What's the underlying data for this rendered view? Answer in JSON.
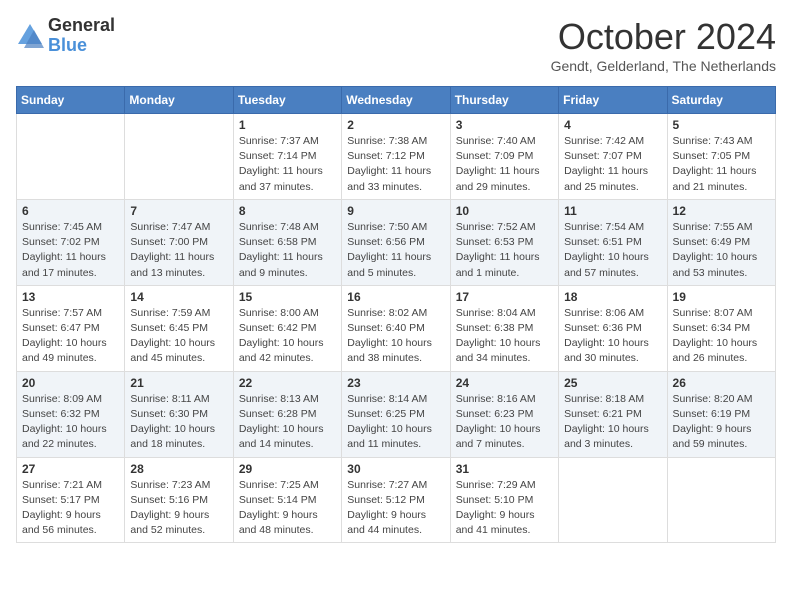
{
  "header": {
    "logo_general": "General",
    "logo_blue": "Blue",
    "month_title": "October 2024",
    "location": "Gendt, Gelderland, The Netherlands"
  },
  "days_of_week": [
    "Sunday",
    "Monday",
    "Tuesday",
    "Wednesday",
    "Thursday",
    "Friday",
    "Saturday"
  ],
  "weeks": [
    [
      {
        "day": "",
        "info": ""
      },
      {
        "day": "",
        "info": ""
      },
      {
        "day": "1",
        "info": "Sunrise: 7:37 AM\nSunset: 7:14 PM\nDaylight: 11 hours and 37 minutes."
      },
      {
        "day": "2",
        "info": "Sunrise: 7:38 AM\nSunset: 7:12 PM\nDaylight: 11 hours and 33 minutes."
      },
      {
        "day": "3",
        "info": "Sunrise: 7:40 AM\nSunset: 7:09 PM\nDaylight: 11 hours and 29 minutes."
      },
      {
        "day": "4",
        "info": "Sunrise: 7:42 AM\nSunset: 7:07 PM\nDaylight: 11 hours and 25 minutes."
      },
      {
        "day": "5",
        "info": "Sunrise: 7:43 AM\nSunset: 7:05 PM\nDaylight: 11 hours and 21 minutes."
      }
    ],
    [
      {
        "day": "6",
        "info": "Sunrise: 7:45 AM\nSunset: 7:02 PM\nDaylight: 11 hours and 17 minutes."
      },
      {
        "day": "7",
        "info": "Sunrise: 7:47 AM\nSunset: 7:00 PM\nDaylight: 11 hours and 13 minutes."
      },
      {
        "day": "8",
        "info": "Sunrise: 7:48 AM\nSunset: 6:58 PM\nDaylight: 11 hours and 9 minutes."
      },
      {
        "day": "9",
        "info": "Sunrise: 7:50 AM\nSunset: 6:56 PM\nDaylight: 11 hours and 5 minutes."
      },
      {
        "day": "10",
        "info": "Sunrise: 7:52 AM\nSunset: 6:53 PM\nDaylight: 11 hours and 1 minute."
      },
      {
        "day": "11",
        "info": "Sunrise: 7:54 AM\nSunset: 6:51 PM\nDaylight: 10 hours and 57 minutes."
      },
      {
        "day": "12",
        "info": "Sunrise: 7:55 AM\nSunset: 6:49 PM\nDaylight: 10 hours and 53 minutes."
      }
    ],
    [
      {
        "day": "13",
        "info": "Sunrise: 7:57 AM\nSunset: 6:47 PM\nDaylight: 10 hours and 49 minutes."
      },
      {
        "day": "14",
        "info": "Sunrise: 7:59 AM\nSunset: 6:45 PM\nDaylight: 10 hours and 45 minutes."
      },
      {
        "day": "15",
        "info": "Sunrise: 8:00 AM\nSunset: 6:42 PM\nDaylight: 10 hours and 42 minutes."
      },
      {
        "day": "16",
        "info": "Sunrise: 8:02 AM\nSunset: 6:40 PM\nDaylight: 10 hours and 38 minutes."
      },
      {
        "day": "17",
        "info": "Sunrise: 8:04 AM\nSunset: 6:38 PM\nDaylight: 10 hours and 34 minutes."
      },
      {
        "day": "18",
        "info": "Sunrise: 8:06 AM\nSunset: 6:36 PM\nDaylight: 10 hours and 30 minutes."
      },
      {
        "day": "19",
        "info": "Sunrise: 8:07 AM\nSunset: 6:34 PM\nDaylight: 10 hours and 26 minutes."
      }
    ],
    [
      {
        "day": "20",
        "info": "Sunrise: 8:09 AM\nSunset: 6:32 PM\nDaylight: 10 hours and 22 minutes."
      },
      {
        "day": "21",
        "info": "Sunrise: 8:11 AM\nSunset: 6:30 PM\nDaylight: 10 hours and 18 minutes."
      },
      {
        "day": "22",
        "info": "Sunrise: 8:13 AM\nSunset: 6:28 PM\nDaylight: 10 hours and 14 minutes."
      },
      {
        "day": "23",
        "info": "Sunrise: 8:14 AM\nSunset: 6:25 PM\nDaylight: 10 hours and 11 minutes."
      },
      {
        "day": "24",
        "info": "Sunrise: 8:16 AM\nSunset: 6:23 PM\nDaylight: 10 hours and 7 minutes."
      },
      {
        "day": "25",
        "info": "Sunrise: 8:18 AM\nSunset: 6:21 PM\nDaylight: 10 hours and 3 minutes."
      },
      {
        "day": "26",
        "info": "Sunrise: 8:20 AM\nSunset: 6:19 PM\nDaylight: 9 hours and 59 minutes."
      }
    ],
    [
      {
        "day": "27",
        "info": "Sunrise: 7:21 AM\nSunset: 5:17 PM\nDaylight: 9 hours and 56 minutes."
      },
      {
        "day": "28",
        "info": "Sunrise: 7:23 AM\nSunset: 5:16 PM\nDaylight: 9 hours and 52 minutes."
      },
      {
        "day": "29",
        "info": "Sunrise: 7:25 AM\nSunset: 5:14 PM\nDaylight: 9 hours and 48 minutes."
      },
      {
        "day": "30",
        "info": "Sunrise: 7:27 AM\nSunset: 5:12 PM\nDaylight: 9 hours and 44 minutes."
      },
      {
        "day": "31",
        "info": "Sunrise: 7:29 AM\nSunset: 5:10 PM\nDaylight: 9 hours and 41 minutes."
      },
      {
        "day": "",
        "info": ""
      },
      {
        "day": "",
        "info": ""
      }
    ]
  ]
}
